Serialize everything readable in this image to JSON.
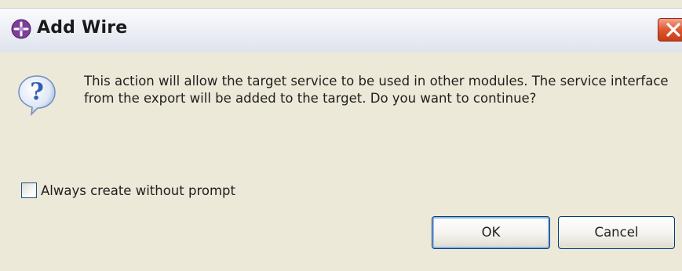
{
  "dialog": {
    "title": "Add Wire",
    "message": "This action will allow the target service to be used in other modules. The service interface from the export will be added to the target. Do you want to continue?",
    "checkbox_label": "Always create without prompt",
    "checkbox_checked": false,
    "ok_label": "OK",
    "cancel_label": "Cancel"
  },
  "icons": {
    "app": "add-wire-app-icon",
    "close": "close-icon",
    "message": "question-icon"
  },
  "colors": {
    "dialog_background": "#ece9d8",
    "close_button": "#e0572f",
    "question_icon": "#2f5fb3",
    "button_border": "#003c74"
  }
}
